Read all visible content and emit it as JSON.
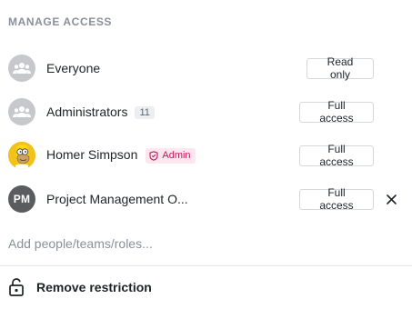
{
  "section": {
    "title": "MANAGE ACCESS"
  },
  "rows": [
    {
      "name": "Everyone",
      "avatar_icon": "group-icon",
      "access": "Read only"
    },
    {
      "name": "Administrators",
      "avatar_icon": "group-icon",
      "count": "11",
      "access": "Full access"
    },
    {
      "name": "Homer Simpson",
      "avatar_icon": "user-photo",
      "badge": "Admin",
      "badge_icon": "shield-icon",
      "access": "Full access"
    },
    {
      "name": "Project Management O...",
      "initials": "PM",
      "access": "Full access",
      "remove_icon": "close-icon"
    }
  ],
  "add_field": {
    "placeholder": "Add people/teams/roles..."
  },
  "footer": {
    "remove_restriction_label": "Remove restriction",
    "icon": "unlock-icon"
  },
  "colors": {
    "admin_badge_text": "#c2185b",
    "admin_badge_bg": "#fde6ee",
    "group_avatar_bg": "#c6c8cc",
    "initials_avatar_bg": "#5a5c60"
  }
}
